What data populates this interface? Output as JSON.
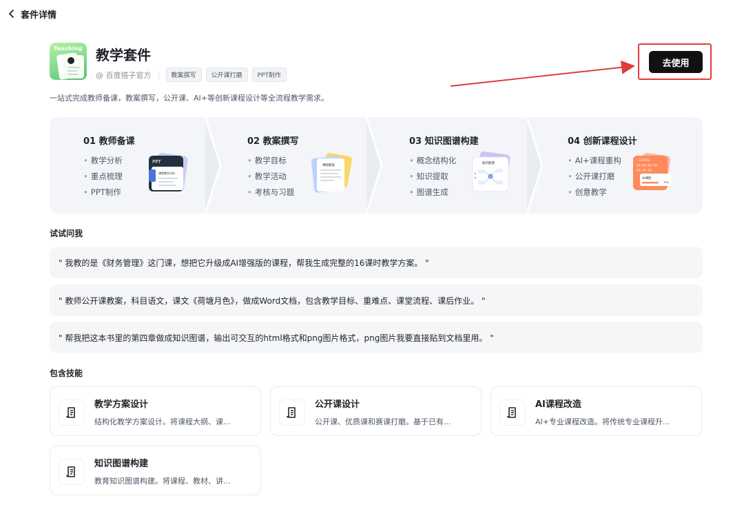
{
  "topbar": {
    "back_icon": "chevron-left-icon",
    "title": "套件详情"
  },
  "suite": {
    "logo_text": "Teaching",
    "title": "教学套件",
    "author": "@ 百度搭子官方",
    "tags": [
      "教案撰写",
      "公开课打磨",
      "PPT制作"
    ],
    "description": "一站式完成教师备课，教案撰写，公开课、AI+等创新课程设计等全流程教学需求。",
    "use_button": "去使用",
    "highlight_color": "#e23b3b"
  },
  "flow": {
    "steps": [
      {
        "title": "01 教师备课",
        "items": [
          "教学分析",
          "重点梳理",
          "PPT制作"
        ],
        "illus_label": "PPT",
        "illus_sub": "课程教学分析"
      },
      {
        "title": "02 教案撰写",
        "items": [
          "教学目标",
          "教学活动",
          "考核与习题"
        ],
        "illus_label": "课程教案"
      },
      {
        "title": "03 知识图谱构建",
        "items": [
          "概念结构化",
          "知识提取",
          "图谱生成"
        ],
        "illus_label": "知识图谱"
      },
      {
        "title": "04 创新课程设计",
        "items": [
          "AI+课程重构",
          "公开课打磨",
          "创意教学"
        ],
        "illus_label": "AI课程",
        "illus_top": "COURSE",
        "illus_pct": "70%"
      }
    ]
  },
  "try_ask": {
    "heading": "试试问我",
    "prompts": [
      "\" 我教的是《财务管理》这门课，想把它升级成AI增强版的课程，帮我生成完整的16课时教学方案。 \"",
      "\" 教师公开课教案，科目语文，课文《荷塘月色》，做成Word文档，包含教学目标、重难点、课堂流程、课后作业。 \"",
      "\" 帮我把这本书里的第四章做成知识图谱，输出可交互的html格式和png图片格式，png图片我要直接贴到文档里用。 \""
    ]
  },
  "skills": {
    "heading": "包含技能",
    "items": [
      {
        "name": "教学方案设计",
        "desc": "结构化教学方案设计。将课程大纲、课...",
        "icon": "scroll-icon"
      },
      {
        "name": "公开课设计",
        "desc": "公开课、优质课和赛课打磨。基于已有...",
        "icon": "scroll-icon"
      },
      {
        "name": "AI课程改造",
        "desc": "AI+专业课程改造。将传统专业课程升...",
        "icon": "scroll-icon"
      },
      {
        "name": "知识图谱构建",
        "desc": "教育知识图谱构建。将课程、教材、讲...",
        "icon": "scroll-icon"
      }
    ]
  }
}
